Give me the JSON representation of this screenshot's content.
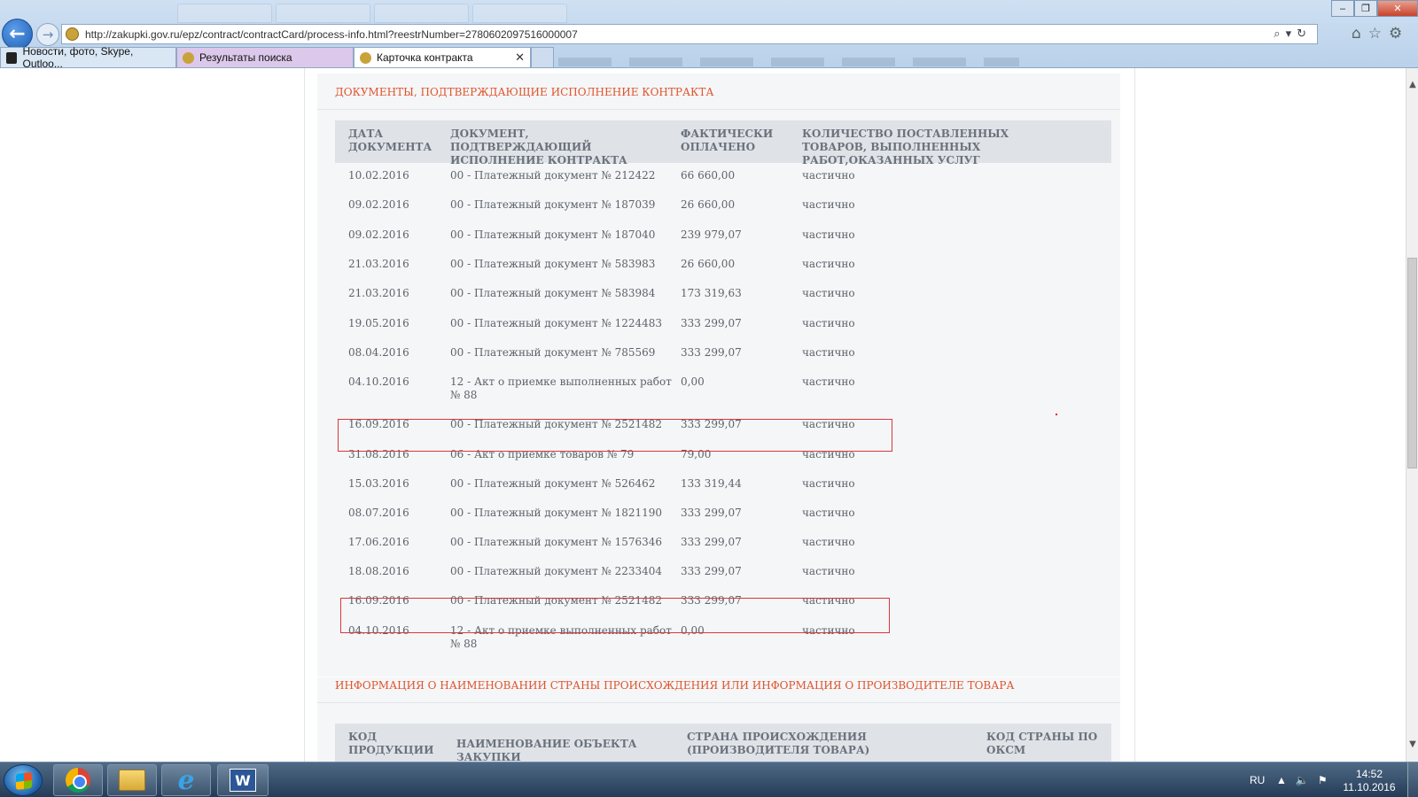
{
  "browser": {
    "url": "http://zakupki.gov.ru/epz/contract/contractCard/process-info.html?reestrNumber=2780602097516000007",
    "tabs": [
      {
        "label": "Новости, фото, Skype, Outloo..."
      },
      {
        "label": "Результаты поиска"
      },
      {
        "label": "Карточка контракта"
      }
    ],
    "win_buttons": {
      "minimize": "‒",
      "maximize": "❐",
      "close": "✕"
    }
  },
  "section_docs": {
    "title": "ДОКУМЕНТЫ, ПОДТВЕРЖДАЮЩИЕ ИСПОЛНЕНИЕ КОНТРАКТА",
    "headers": {
      "date": "ДАТА ДОКУМЕНТА",
      "doc": "ДОКУМЕНТ, ПОДТВЕРЖДАЮЩИЙ ИСПОЛНЕНИЕ КОНТРАКТА",
      "paid": "ФАКТИЧЕСКИ ОПЛАЧЕНО",
      "qty": "КОЛИЧЕСТВО ПОСТАВЛЕННЫХ ТОВАРОВ, ВЫПОЛНЕННЫХ РАБОТ,ОКАЗАННЫХ УСЛУГ"
    },
    "rows": [
      {
        "date": "10.02.2016",
        "doc": "00 - Платежный документ № 212422",
        "paid": "66 660,00",
        "qty": "частично"
      },
      {
        "date": "09.02.2016",
        "doc": "00 - Платежный документ № 187039",
        "paid": "26 660,00",
        "qty": "частично"
      },
      {
        "date": "09.02.2016",
        "doc": "00 - Платежный документ № 187040",
        "paid": "239 979,07",
        "qty": "частично"
      },
      {
        "date": "21.03.2016",
        "doc": "00 - Платежный документ № 583983",
        "paid": "26 660,00",
        "qty": "частично"
      },
      {
        "date": "21.03.2016",
        "doc": "00 - Платежный документ № 583984",
        "paid": "173 319,63",
        "qty": "частично"
      },
      {
        "date": "19.05.2016",
        "doc": "00 - Платежный документ № 1224483",
        "paid": "333 299,07",
        "qty": "частично"
      },
      {
        "date": "08.04.2016",
        "doc": "00 - Платежный документ № 785569",
        "paid": "333 299,07",
        "qty": "частично"
      },
      {
        "date": "04.10.2016",
        "doc": "12 - Акт о приемке выполненных работ № 88",
        "paid": "0,00",
        "qty": "частично"
      },
      {
        "date": "16.09.2016",
        "doc": "00 - Платежный документ № 2521482",
        "paid": "333 299,07",
        "qty": "частично"
      },
      {
        "date": "31.08.2016",
        "doc": "06 - Акт о приемке товаров № 79",
        "paid": "79,00",
        "qty": "частично"
      },
      {
        "date": "15.03.2016",
        "doc": "00 - Платежный документ № 526462",
        "paid": "133 319,44",
        "qty": "частично"
      },
      {
        "date": "08.07.2016",
        "doc": "00 - Платежный документ № 1821190",
        "paid": "333 299,07",
        "qty": "частично"
      },
      {
        "date": "17.06.2016",
        "doc": "00 - Платежный документ № 1576346",
        "paid": "333 299,07",
        "qty": "частично"
      },
      {
        "date": "18.08.2016",
        "doc": "00 - Платежный документ № 2233404",
        "paid": "333 299,07",
        "qty": "частично"
      },
      {
        "date": "16.09.2016",
        "doc": "00 - Платежный документ № 2521482",
        "paid": "333 299,07",
        "qty": "частично"
      },
      {
        "date": "04.10.2016",
        "doc": "12 - Акт о приемке выполненных работ № 88",
        "paid": "0,00",
        "qty": "частично"
      }
    ],
    "highlight_color": "#d8383b"
  },
  "section_origin": {
    "title": "ИНФОРМАЦИЯ О НАИМЕНОВАНИИ СТРАНЫ ПРОИСХОЖДЕНИЯ ИЛИ ИНФОРМАЦИЯ О ПРОИЗВОДИТЕЛЕ ТОВАРА",
    "headers": {
      "code": "КОД ПРОДУКЦИИ",
      "name": "НАИМЕНОВАНИЕ ОБЪЕКТА ЗАКУПКИ",
      "country": "СТРАНА ПРОИСХОЖДЕНИЯ (ПРОИЗВОДИТЕЛЯ ТОВАРА)",
      "oksm": "КОД СТРАНЫ ПО ОКСМ"
    }
  },
  "taskbar": {
    "lang": "RU",
    "time": "14:52",
    "date": "11.10.2016"
  },
  "colors": {
    "accent_title": "#e0532c",
    "table_header_bg": "#dfe3e8",
    "panel_bg": "#f5f6f7"
  }
}
